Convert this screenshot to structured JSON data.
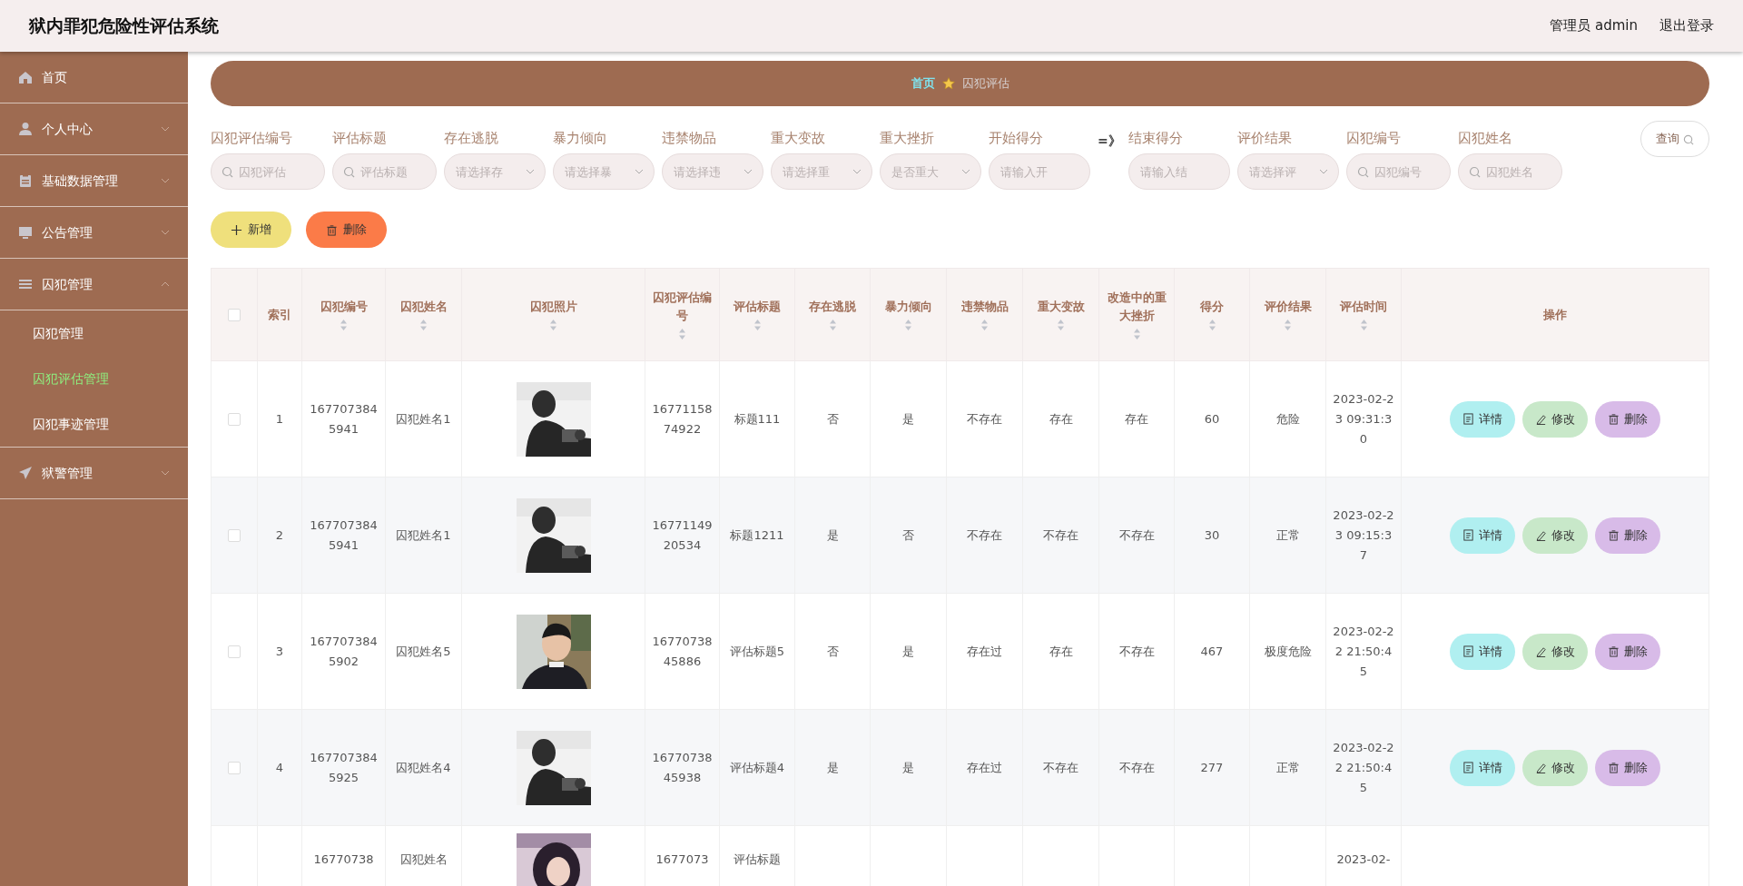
{
  "header": {
    "title": "狱内罪犯危险性评估系统",
    "user": "管理员 admin",
    "logout": "退出登录"
  },
  "sidebar": {
    "items": [
      {
        "label": "首页",
        "kind": "link"
      },
      {
        "label": "个人中心",
        "kind": "group",
        "expanded": false
      },
      {
        "label": "基础数据管理",
        "kind": "group",
        "expanded": false
      },
      {
        "label": "公告管理",
        "kind": "group",
        "expanded": false
      },
      {
        "label": "囚犯管理",
        "kind": "group",
        "expanded": true,
        "children": [
          {
            "label": "囚犯管理",
            "selected": false
          },
          {
            "label": "囚犯评估管理",
            "selected": true
          },
          {
            "label": "囚犯事迹管理",
            "selected": false
          }
        ]
      },
      {
        "label": "狱警管理",
        "kind": "group",
        "expanded": false
      }
    ]
  },
  "breadcrumb": [
    {
      "label": "首页",
      "selected": false
    },
    {
      "label": "囚犯评估",
      "selected": true
    }
  ],
  "filters": [
    {
      "label": "囚犯评估编号",
      "kind": "search",
      "placeholder": "囚犯评估"
    },
    {
      "label": "评估标题",
      "kind": "search",
      "placeholder": "评估标题"
    },
    {
      "label": "存在逃脱",
      "kind": "select",
      "placeholder": "请选择存"
    },
    {
      "label": "暴力倾向",
      "kind": "select",
      "placeholder": "请选择暴"
    },
    {
      "label": "违禁物品",
      "kind": "select",
      "placeholder": "请选择违"
    },
    {
      "label": "重大变故",
      "kind": "select",
      "placeholder": "请选择重"
    },
    {
      "label": "重大挫折",
      "kind": "select",
      "placeholder": "是否重大"
    },
    {
      "label": "开始得分",
      "kind": "input",
      "placeholder": "请输入开"
    },
    {
      "label": "=》",
      "kind": "separator"
    },
    {
      "label": "结束得分",
      "kind": "input",
      "placeholder": "请输入结"
    },
    {
      "label": "评价结果",
      "kind": "select",
      "placeholder": "请选择评"
    },
    {
      "label": "囚犯编号",
      "kind": "search",
      "placeholder": "囚犯编号"
    },
    {
      "label": "囚犯姓名",
      "kind": "search",
      "placeholder": "囚犯姓名"
    }
  ],
  "query_button": "查询",
  "actions": [
    {
      "label": "新增",
      "kind": "add"
    },
    {
      "label": "删除",
      "kind": "delete"
    }
  ],
  "table": {
    "columns": [
      {
        "kind": "check",
        "checked": false
      },
      {
        "label": "索引",
        "kind": "text",
        "sortable": false
      },
      {
        "label": "囚犯编号",
        "kind": "text",
        "sortable": true
      },
      {
        "label": "囚犯姓名",
        "kind": "text",
        "sortable": true
      },
      {
        "label": "囚犯照片",
        "sortable": true
      },
      {
        "label": "囚犯评估编号",
        "kind": "text",
        "sortable": true
      },
      {
        "label": "评估标题",
        "kind": "text",
        "sortable": true
      },
      {
        "label": "存在逃脱",
        "kind": "text",
        "sortable": true
      },
      {
        "label": "暴力倾向",
        "kind": "text",
        "sortable": true
      },
      {
        "label": "违禁物品",
        "kind": "text",
        "sortable": true
      },
      {
        "label": "重大变故",
        "kind": "text",
        "sortable": true
      },
      {
        "label": "改造中的重大挫折",
        "kind": "text",
        "sortable": true
      },
      {
        "label": "得分",
        "kind": "text",
        "sortable": true
      },
      {
        "label": "评价结果",
        "kind": "text",
        "sortable": true
      },
      {
        "label": "评估时间",
        "kind": "text",
        "sortable": true
      },
      {
        "label": "操作",
        "kind": "actions",
        "sortable": false
      }
    ],
    "rows": [
      {
        "checked": false,
        "cells": [
          "",
          "1",
          "1677073845941",
          "囚犯姓名1",
          {
            "kind": "picture"
          },
          "1677115874922",
          "标题111",
          "否",
          "是",
          "不存在",
          "存在",
          "存在",
          "60",
          "危险",
          "2023-02-23 09:31:30"
        ],
        "buttons": [
          {
            "label": "详情",
            "kind": "detail"
          },
          {
            "label": "修改",
            "kind": "edit"
          },
          {
            "label": "删除",
            "kind": "delete"
          }
        ]
      },
      {
        "checked": false,
        "cells": [
          "",
          "2",
          "1677073845941",
          "囚犯姓名1",
          {
            "kind": "picture"
          },
          "1677114920534",
          "标题1211",
          "是",
          "否",
          "不存在",
          "不存在",
          "不存在",
          "30",
          "正常",
          "2023-02-23 09:15:37"
        ],
        "buttons": [
          {
            "label": "详情",
            "kind": "detail"
          },
          {
            "label": "修改",
            "kind": "edit"
          },
          {
            "label": "删除",
            "kind": "delete"
          }
        ]
      },
      {
        "checked": false,
        "cells": [
          "",
          "3",
          "1677073845902",
          "囚犯姓名5",
          {
            "kind": "picture"
          },
          "1677073845886",
          "评估标题5",
          "否",
          "是",
          "存在过",
          "存在",
          "不存在",
          "467",
          "极度危险",
          "2023-02-22 21:50:45"
        ],
        "buttons": [
          {
            "label": "详情",
            "kind": "detail"
          },
          {
            "label": "修改",
            "kind": "edit"
          },
          {
            "label": "删除",
            "kind": "delete"
          }
        ]
      },
      {
        "checked": false,
        "cells": [
          "",
          "4",
          "1677073845925",
          "囚犯姓名4",
          {
            "kind": "picture"
          },
          "1677073845938",
          "评估标题4",
          "是",
          "是",
          "存在过",
          "不存在",
          "不存在",
          "277",
          "正常",
          "2023-02-22 21:50:45"
        ],
        "buttons": [
          {
            "label": "详情",
            "kind": "detail"
          },
          {
            "label": "修改",
            "kind": "edit"
          },
          {
            "label": "删除",
            "kind": "delete"
          }
        ]
      },
      {
        "cells": [
          "",
          "",
          "16770738",
          "囚犯姓名",
          {
            "kind": "picture"
          },
          "1677073",
          "评估标题",
          "",
          "",
          "",
          "",
          "",
          "",
          "",
          "2023-02-"
        ]
      }
    ]
  }
}
